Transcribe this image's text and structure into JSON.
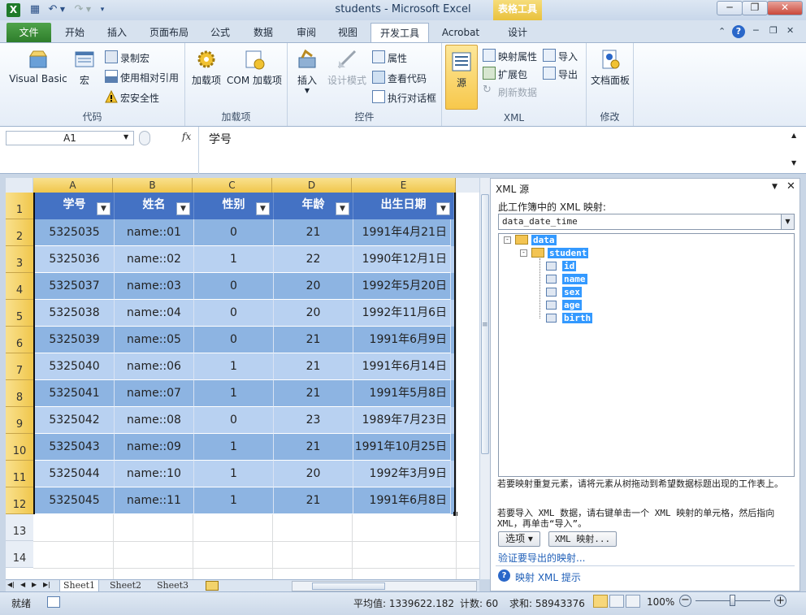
{
  "window": {
    "title": "students  -  Microsoft Excel",
    "contextual_tab_group": "表格工具"
  },
  "tabs": {
    "file": "文件",
    "items": [
      "开始",
      "插入",
      "页面布局",
      "公式",
      "数据",
      "审阅",
      "视图",
      "开发工具",
      "Acrobat",
      "设计"
    ]
  },
  "ribbon": {
    "code": {
      "label": "代码",
      "visual_basic": "Visual Basic",
      "macros": "宏",
      "record_macro": "录制宏",
      "relative_ref": "使用相对引用",
      "macro_security": "宏安全性"
    },
    "addins": {
      "label": "加载项",
      "addins": "加载项",
      "com_addins": "COM 加载项"
    },
    "controls": {
      "label": "控件",
      "insert": "插入",
      "design_mode": "设计模式",
      "properties": "属性",
      "view_code": "查看代码",
      "run_dialog": "执行对话框"
    },
    "xml": {
      "label": "XML",
      "source": "源",
      "map_properties": "映射属性",
      "expansion_packs": "扩展包",
      "refresh_data": "刷新数据",
      "import": "导入",
      "export": "导出"
    },
    "modify": {
      "label": "修改",
      "document_panel": "文档面板"
    }
  },
  "formula_bar": {
    "name_box": "A1",
    "fx": "fx",
    "content": "学号"
  },
  "grid": {
    "columns": [
      "A",
      "B",
      "C",
      "D",
      "E"
    ],
    "headers": [
      "学号",
      "姓名",
      "性别",
      "年龄",
      "出生日期"
    ],
    "rows": [
      [
        "5325035",
        "name::01",
        "0",
        "21",
        "1991年4月21日"
      ],
      [
        "5325036",
        "name::02",
        "1",
        "22",
        "1990年12月1日"
      ],
      [
        "5325037",
        "name::03",
        "0",
        "20",
        "1992年5月20日"
      ],
      [
        "5325038",
        "name::04",
        "0",
        "20",
        "1992年11月6日"
      ],
      [
        "5325039",
        "name::05",
        "0",
        "21",
        "1991年6月9日"
      ],
      [
        "5325040",
        "name::06",
        "1",
        "21",
        "1991年6月14日"
      ],
      [
        "5325041",
        "name::07",
        "1",
        "21",
        "1991年5月8日"
      ],
      [
        "5325042",
        "name::08",
        "0",
        "23",
        "1989年7月23日"
      ],
      [
        "5325043",
        "name::09",
        "1",
        "21",
        "1991年10月25日"
      ],
      [
        "5325044",
        "name::10",
        "1",
        "20",
        "1992年3月9日"
      ],
      [
        "5325045",
        "name::11",
        "1",
        "21",
        "1991年6月8日"
      ]
    ],
    "row_numbers": [
      "1",
      "2",
      "3",
      "4",
      "5",
      "6",
      "7",
      "8",
      "9",
      "10",
      "11",
      "12",
      "13",
      "14"
    ]
  },
  "sheets": [
    "Sheet1",
    "Sheet2",
    "Sheet3"
  ],
  "status": {
    "ready": "就绪",
    "average": "平均值: 1339622.182",
    "count": "计数: 60",
    "sum": "求和: 58943376",
    "zoom": "100%"
  },
  "xml_pane": {
    "title": "XML 源",
    "maps_label": "此工作簿中的 XML 映射:",
    "selected_map": "data_date_time",
    "tree": {
      "root": "data",
      "child": "student",
      "fields": [
        "id",
        "name",
        "sex",
        "age",
        "birth"
      ]
    },
    "hint1": "若要映射重复元素，请将元素从树拖动到希望数据标题出现的工作表上。",
    "hint2": "若要导入 XML 数据，请右键单击一个 XML 映射的单元格，然后指向 XML，再单击“导入”。",
    "options_btn": "选项 ▾",
    "xml_maps_btn": "XML 映射...",
    "verify_link": "验证要导出的映射...",
    "tips_link": "映射 XML 提示"
  },
  "colors": {
    "header_fill": "#4472c4",
    "band_dark": "#8db4e2",
    "band_light": "#b8d1f1",
    "selection": "#f0c64b"
  }
}
